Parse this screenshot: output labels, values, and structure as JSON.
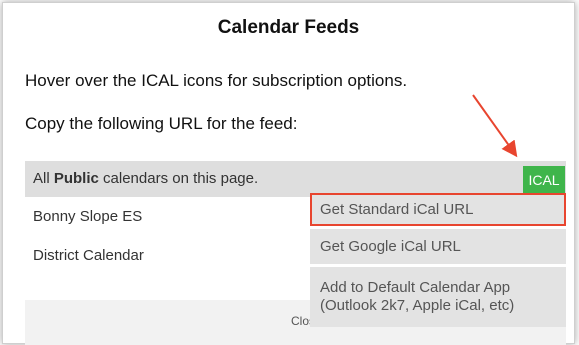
{
  "dialog": {
    "title": "Calendar Feeds",
    "hover_text": "Hover over the ICAL icons for subscription options.",
    "copy_text": "Copy the following URL for the feed:",
    "close_label": "Close"
  },
  "rows": [
    {
      "prefix": "All ",
      "bold": "Public",
      "suffix": " calendars on this page.",
      "button": "ICAL"
    },
    {
      "label": "Bonny Slope ES"
    },
    {
      "label": "District Calendar"
    }
  ],
  "menu": {
    "items": [
      {
        "line1": "Get Standard iCal URL"
      },
      {
        "line1": "Get Google iCal URL"
      },
      {
        "line1": "Add to Default Calendar App",
        "line2": "(Outlook 2k7, Apple iCal, etc)"
      }
    ]
  },
  "colors": {
    "ical_green": "#3fb54b",
    "highlight_red": "#e8452f",
    "row_gray": "#dedede"
  }
}
